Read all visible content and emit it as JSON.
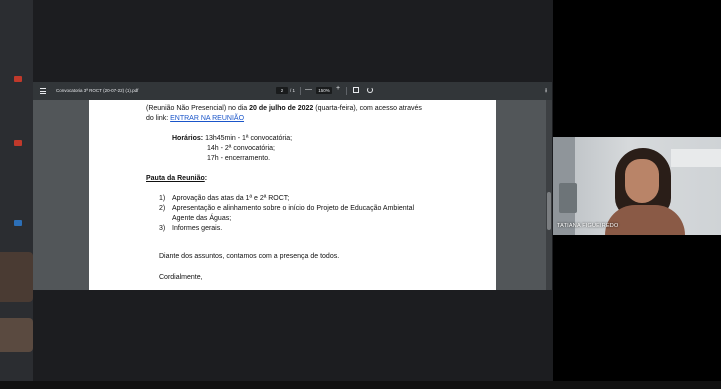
{
  "toolbar": {
    "filename": "Convocatoria 3ª ROCT (20-07-22) (1).pdf",
    "page_current": "2",
    "page_total": "/ 1",
    "zoom_minus": "—",
    "zoom_value": "150%",
    "zoom_plus": "+",
    "download_icon": "download-icon",
    "print_icon": "print-icon",
    "more_icon": "more-vert-icon"
  },
  "document": {
    "intro_line1_a": "(Reunião Não Presencial) no dia ",
    "intro_line1_date": "20 de julho de 2022",
    "intro_line1_b": " (quarta-feira), com acesso através",
    "intro_line2_a": "do link: ",
    "intro_link": "ENTRAR NA REUNIÃO",
    "horarios_label": "Horários:",
    "horario_1": "13h45min - 1ª convocatória;",
    "horario_2": "14h - 2ª convocatória;",
    "horario_3": "17h - encerramento.",
    "pauta_title": "Pauta da Reunião",
    "pauta_colon": ":",
    "item1_num": "1)",
    "item1": "Aprovação das atas da 1ª e 2ª ROCT;",
    "item2_num": "2)",
    "item2_line1": "Apresentação e alinhamento sobre o início do Projeto de Educação Ambiental",
    "item2_line2": "Agente das Águas;",
    "item3_num": "3)",
    "item3": "Informes gerais.",
    "closing": "Diante dos assuntos, contamos com a presença de todos.",
    "signoff": "Cordialmente,"
  },
  "camera": {
    "participant_name": "TATIANA FIGUEIREDO"
  },
  "colors": {
    "viewer_bg": "#525659",
    "toolbar_bg": "#323639",
    "link": "#1a55c9",
    "app_bg": "#202124"
  }
}
